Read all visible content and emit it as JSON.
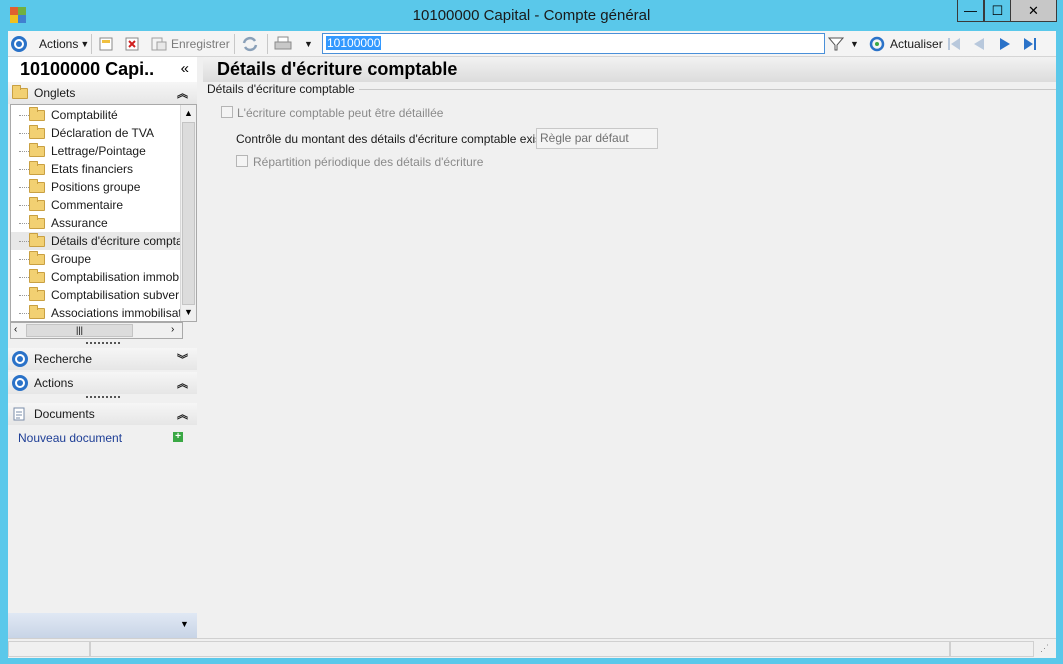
{
  "window": {
    "title": "10100000 Capital -  Compte général",
    "controls": {
      "minimize": "—",
      "maximize": "☐",
      "close": "✕"
    }
  },
  "toolbar": {
    "actions_label": "Actions",
    "save_label": "Enregistrer",
    "search_value": "10100000",
    "refresh_label": "Actualiser"
  },
  "left_panel": {
    "title": "10100000 Capi..",
    "collapse_glyph": "«",
    "tabs_section": "Onglets",
    "tree_items": [
      "Comptabilité",
      "Déclaration de TVA",
      "Lettrage/Pointage",
      "Etats financiers",
      "Positions groupe",
      "Commentaire",
      "Assurance",
      "Détails d'écriture compta",
      "Groupe",
      "Comptabilisation immob",
      "Comptabilisation subver",
      "Associations immobilisat"
    ],
    "selected_index": 7,
    "search_section": "Recherche",
    "actions_section": "Actions",
    "documents_section": "Documents",
    "new_document_link": "Nouveau document"
  },
  "main": {
    "title": "Détails d'écriture comptable",
    "group_label": "Détails d'écriture comptable",
    "checkbox_detailed": "L'écriture comptable peut être détaillée",
    "control_label": "Contrôle du montant des détails d'écriture comptable existants :",
    "control_value": "Règle par défaut",
    "checkbox_periodic": "Répartition périodique des détails d'écriture"
  },
  "colors": {
    "window_frame": "#5ac8ea",
    "accent_blue": "#2a72c8",
    "link": "#1e3e96"
  }
}
